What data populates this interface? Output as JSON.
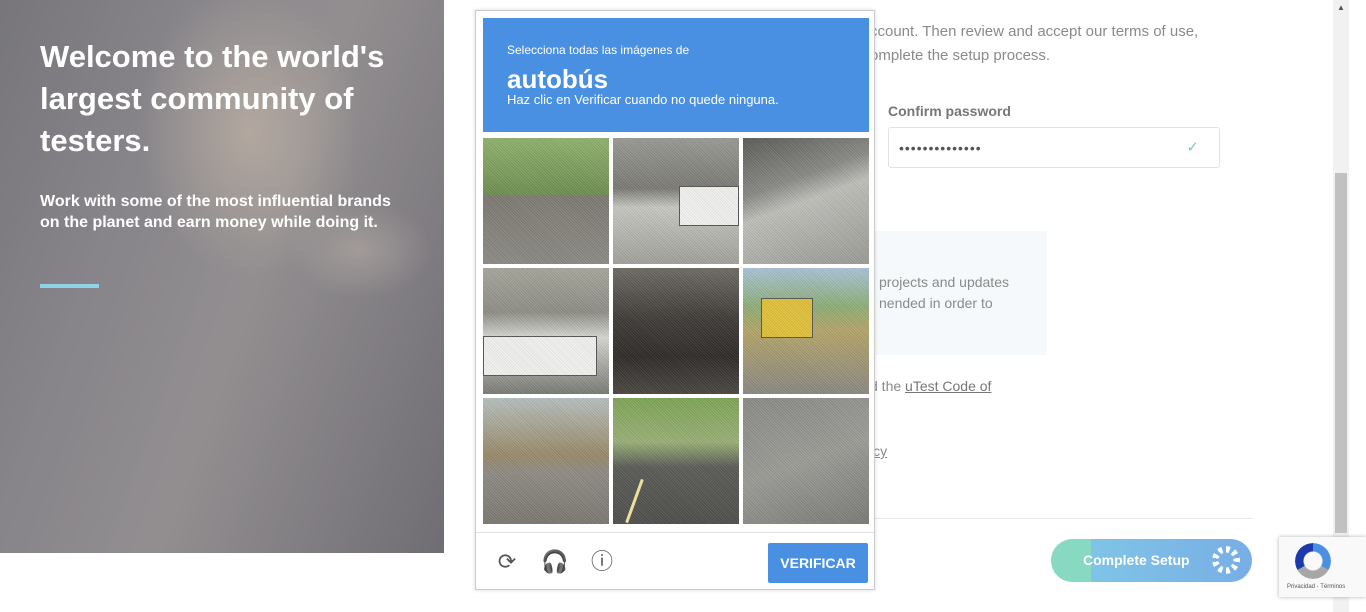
{
  "hero": {
    "title": "Welcome to the world's largest community of testers.",
    "subtitle": "Work with some of the most influential brands on the planet and earn money while doing it."
  },
  "page": {
    "intro_text": "ccount. Then review and accept our terms of use, omplete the setup process.",
    "confirm_password_label": "Confirm password",
    "confirm_password_value": "••••••••••••••",
    "info_text": "projects and updates nended in order to",
    "code_prefix": "d the ",
    "code_link": "uTest Code of",
    "policy_fragment": "icy",
    "complete_button": "Complete Setup"
  },
  "captcha": {
    "instruction": "Selecciona todas las imágenes de",
    "target": "autobús",
    "hint": "Haz clic en Verificar cuando no quede ninguna.",
    "verify_label": "VERIFICAR",
    "footer_icons": [
      "reload-icon",
      "headphones-icon",
      "info-icon"
    ]
  },
  "recaptcha_badge": {
    "links": "Privacidad - Términos"
  },
  "colors": {
    "captcha_blue": "#4a90e2",
    "hero_rule": "#8fd4e6",
    "complete_start": "#88d9c1",
    "complete_end": "#78aee5"
  }
}
